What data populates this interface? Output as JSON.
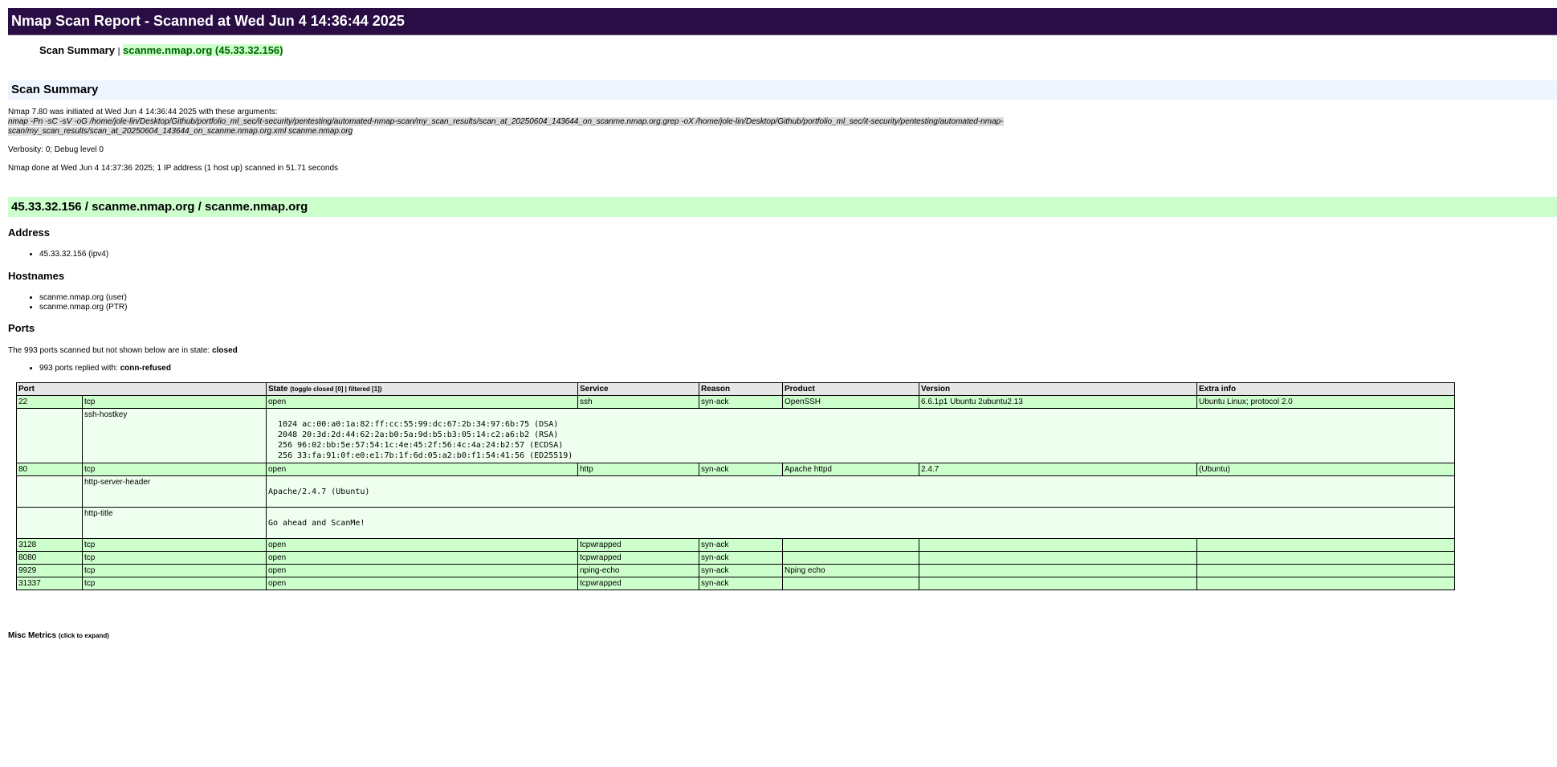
{
  "report": {
    "title": "Nmap Scan Report - Scanned at Wed Jun 4 14:36:44 2025"
  },
  "toc": {
    "summary_link": "Scan Summary",
    "separator": "|",
    "host_link": "scanme.nmap.org (45.33.32.156)"
  },
  "summary": {
    "heading": "Scan Summary",
    "initiated": "Nmap 7.80 was initiated at Wed Jun 4 14:36:44 2025 with these arguments:",
    "args_line1": "nmap -Pn -sC -sV -oG /home/jole-lin/Desktop/Github/portfolio_ml_sec/it-security/pentesting/automated-nmap-scan/my_scan_results/scan_at_20250604_143644_on_scanme.nmap.org.grep -oX /home/jole-lin/Desktop/Github/portfolio_ml_sec/it-security/pentesting/automated-nmap-",
    "args_line2": "scan/my_scan_results/scan_at_20250604_143644_on_scanme.nmap.org.xml scanme.nmap.org",
    "verbosity": "Verbosity: 0; Debug level 0",
    "done": "Nmap done at Wed Jun 4 14:37:36 2025; 1 IP address (1 host up) scanned in 51.71 seconds"
  },
  "host": {
    "heading": "45.33.32.156 / scanme.nmap.org / scanme.nmap.org",
    "address_heading": "Address",
    "address_item": "45.33.32.156 (ipv4)",
    "hostnames_heading": "Hostnames",
    "hostname_user": "scanme.nmap.org (user)",
    "hostname_ptr": "scanme.nmap.org (PTR)",
    "ports_heading": "Ports",
    "extraports_text": "The 993 ports scanned but not shown below are in state: ",
    "extraports_state": "closed",
    "replied_text": "993 ports replied with: ",
    "replied_reason": "conn-refused"
  },
  "table": {
    "headers": {
      "port": "Port",
      "state": "State",
      "state_toggle": "(toggle closed [0] | filtered [1])",
      "service": "Service",
      "reason": "Reason",
      "product": "Product",
      "version": "Version",
      "extra": "Extra info"
    },
    "rows": [
      {
        "port": "22",
        "proto": "tcp",
        "state": "open",
        "service": "ssh",
        "reason": "syn-ack",
        "product": "OpenSSH",
        "version": "6.6.1p1 Ubuntu 2ubuntu2.13",
        "extra": "Ubuntu Linux; protocol 2.0"
      },
      {
        "port": "80",
        "proto": "tcp",
        "state": "open",
        "service": "http",
        "reason": "syn-ack",
        "product": "Apache httpd",
        "version": "2.4.7",
        "extra": "(Ubuntu)"
      },
      {
        "port": "3128",
        "proto": "tcp",
        "state": "open",
        "service": "tcpwrapped",
        "reason": "syn-ack",
        "product": "",
        "version": "",
        "extra": ""
      },
      {
        "port": "8080",
        "proto": "tcp",
        "state": "open",
        "service": "tcpwrapped",
        "reason": "syn-ack",
        "product": "",
        "version": "",
        "extra": ""
      },
      {
        "port": "9929",
        "proto": "tcp",
        "state": "open",
        "service": "nping-echo",
        "reason": "syn-ack",
        "product": "Nping echo",
        "version": "",
        "extra": ""
      },
      {
        "port": "31337",
        "proto": "tcp",
        "state": "open",
        "service": "tcpwrapped",
        "reason": "syn-ack",
        "product": "",
        "version": "",
        "extra": ""
      }
    ],
    "scripts": {
      "ssh_hostkey": {
        "name": "ssh-hostkey",
        "output": "\n  1024 ac:00:a0:1a:82:ff:cc:55:99:dc:67:2b:34:97:6b:75 (DSA)\n  2048 20:3d:2d:44:62:2a:b0:5a:9d:b5:b3:05:14:c2:a6:b2 (RSA)\n  256 96:02:bb:5e:57:54:1c:4e:45:2f:56:4c:4a:24:b2:57 (ECDSA)\n  256 33:fa:91:0f:e0:e1:7b:1f:6d:05:a2:b0:f1:54:41:56 (ED25519)\n"
      },
      "http_server_header": {
        "name": "http-server-header",
        "output": "Apache/2.4.7 (Ubuntu)"
      },
      "http_title": {
        "name": "http-title",
        "output": "Go ahead and ScanMe!"
      }
    }
  },
  "misc": {
    "label": "Misc Metrics",
    "hint": "(click to expand)"
  },
  "colors": {
    "title_bg": "#2a0d45",
    "summary_bg": "#eef5ff",
    "host_bg": "#ccffcc",
    "open_row": "#ccffcc",
    "script_row": "#efffef",
    "link_hl": "#006600"
  }
}
